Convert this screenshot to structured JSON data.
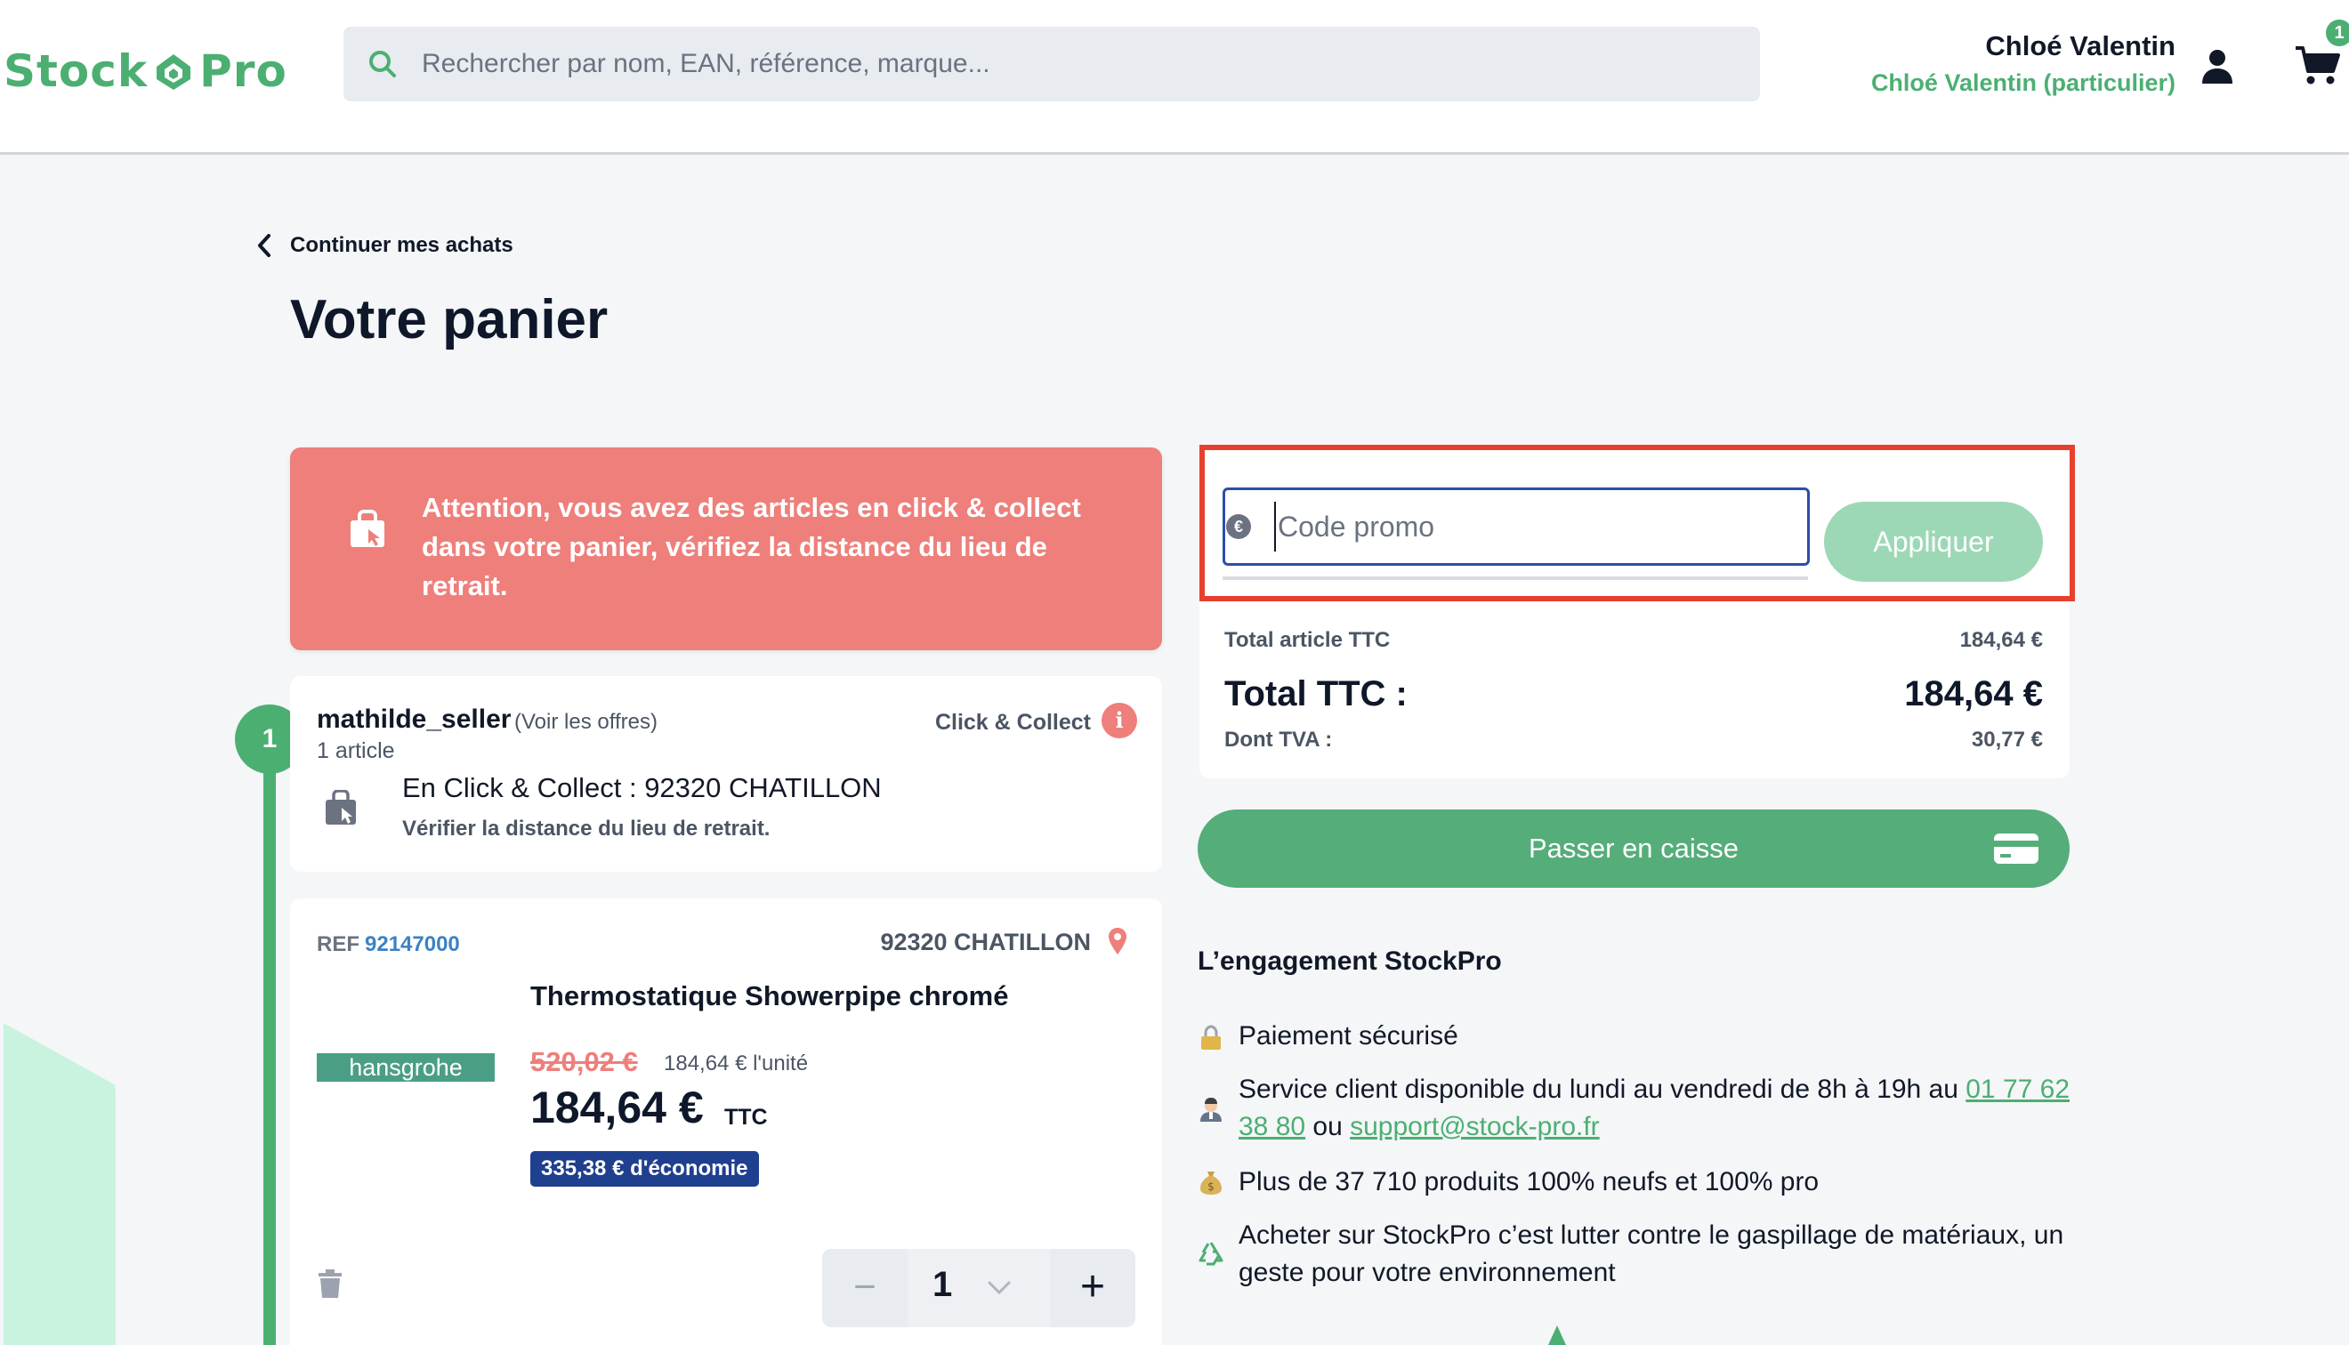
{
  "header": {
    "logo": "Stock Pro",
    "search_placeholder": "Rechercher par nom, EAN, référence, marque...",
    "user_name": "Chloé Valentin",
    "user_sub": "Chloé Valentin (particulier)",
    "cart_count": "1"
  },
  "nav": {
    "back_label": "Continuer mes achats"
  },
  "page": {
    "title": "Votre panier"
  },
  "alert": {
    "text": "Attention, vous avez des articles en click & collect dans votre panier, vérifiez la distance du lieu de retrait."
  },
  "seller": {
    "step": "1",
    "name": "mathilde_seller",
    "offers_link": "(Voir les offres)",
    "count": "1 article",
    "delivery_mode": "Click & Collect",
    "address": "En Click & Collect : 92320 CHATILLON",
    "verify": "Vérifier la distance du lieu de retrait."
  },
  "product": {
    "ref_label": "REF",
    "ref_value": "92147000",
    "location": "92320 CHATILLON",
    "title": "Thermostatique Showerpipe chromé",
    "brand": "hansgrohe",
    "old_price": "520,02 €",
    "unit_price": "184,64 € l'unité",
    "price": "184,64 €",
    "price_suffix": "TTC",
    "saving": "335,38 € d'économie",
    "quantity": "1",
    "minus": "−",
    "plus": "+"
  },
  "summary": {
    "promo_placeholder": "Code promo",
    "promo_value": "",
    "apply_label": "Appliquer",
    "article_total_label": "Total article TTC",
    "article_total_value": "184,64 €",
    "total_label": "Total TTC :",
    "total_value": "184,64 €",
    "vat_label": "Dont TVA :",
    "vat_value": "30,77 €",
    "checkout_label": "Passer en caisse"
  },
  "engagement": {
    "title": "L’engagement StockPro",
    "secure": "Paiement sécurisé",
    "service_prefix": "Service client disponible du lundi au vendredi de 8h à 19h au ",
    "service_phone": "01 77 62 38 80",
    "service_or": " ou ",
    "service_email": "support@stock-pro.fr",
    "products": "Plus de 37 710 produits 100% neufs et 100% pro",
    "waste": "Acheter sur StockPro c’est lutter contre le gaspillage de matériaux, un geste pour votre environnement"
  },
  "colors": {
    "brand_green": "#4caf72",
    "alert_red": "#ee7f7b",
    "highlight_red": "#e8402f",
    "saving_blue": "#1f3f8f",
    "ref_blue": "#3b82c4"
  },
  "icons": [
    "search-icon",
    "user-icon",
    "cart-icon",
    "chevron-left-icon",
    "click-collect-bag-icon",
    "info-icon",
    "location-pin-icon",
    "trash-icon",
    "chevron-down-icon",
    "euro-icon",
    "credit-card-icon",
    "lock-icon",
    "support-agent-icon",
    "money-bag-icon",
    "recycle-icon"
  ]
}
